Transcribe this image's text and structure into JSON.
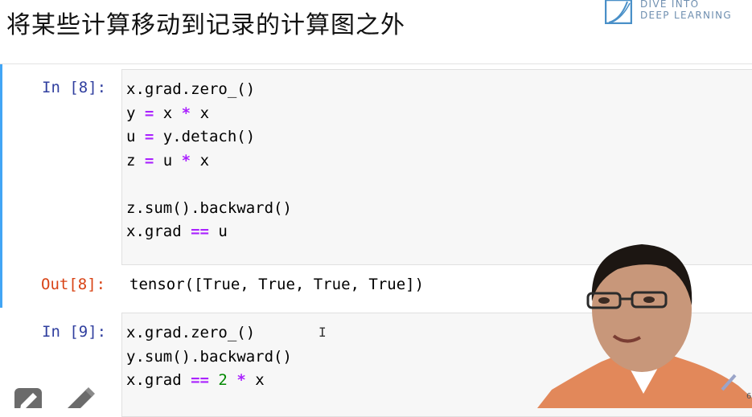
{
  "slide": {
    "title": "将某些计算移动到记录的计算图之外",
    "logo_line1": "DIVE INTO",
    "logo_line2": "DEEP LEARNING",
    "page_number": "6"
  },
  "cells": [
    {
      "prompt": "In [8]:",
      "lines": [
        [
          {
            "t": "x.grad.zero_()",
            "c": ""
          }
        ],
        [
          {
            "t": "y ",
            "c": ""
          },
          {
            "t": "=",
            "c": "k"
          },
          {
            "t": " x ",
            "c": ""
          },
          {
            "t": "*",
            "c": "k"
          },
          {
            "t": " x",
            "c": ""
          }
        ],
        [
          {
            "t": "u ",
            "c": ""
          },
          {
            "t": "=",
            "c": "k"
          },
          {
            "t": " y.detach()",
            "c": ""
          }
        ],
        [
          {
            "t": "z ",
            "c": ""
          },
          {
            "t": "=",
            "c": "k"
          },
          {
            "t": " u ",
            "c": ""
          },
          {
            "t": "*",
            "c": "k"
          },
          {
            "t": " x",
            "c": ""
          }
        ],
        [
          {
            "t": "",
            "c": ""
          }
        ],
        [
          {
            "t": "z.sum().backward()",
            "c": ""
          }
        ],
        [
          {
            "t": "x.grad ",
            "c": ""
          },
          {
            "t": "==",
            "c": "k"
          },
          {
            "t": " u",
            "c": ""
          }
        ]
      ],
      "out_prompt": "Out[8]:",
      "output": "tensor([True, True, True, True])"
    },
    {
      "prompt": "In [9]:",
      "lines": [
        [
          {
            "t": "x.grad.zero_()",
            "c": ""
          }
        ],
        [
          {
            "t": "y.sum().backward()",
            "c": ""
          }
        ],
        [
          {
            "t": "x.grad ",
            "c": ""
          },
          {
            "t": "==",
            "c": "k"
          },
          {
            "t": " ",
            "c": ""
          },
          {
            "t": "2",
            "c": "n"
          },
          {
            "t": " ",
            "c": ""
          },
          {
            "t": "*",
            "c": "k"
          },
          {
            "t": " x",
            "c": ""
          }
        ]
      ]
    }
  ],
  "cursor_glyph": "I",
  "icons": [
    "edit-pencil-box-icon",
    "pencil-icon",
    "pen-tool-icon"
  ],
  "colors": {
    "in_prompt": "#303f9f",
    "out_prompt": "#d84315",
    "operator": "#aa22ff",
    "number": "#008800",
    "selected_cell_bar": "#42a5f5"
  }
}
